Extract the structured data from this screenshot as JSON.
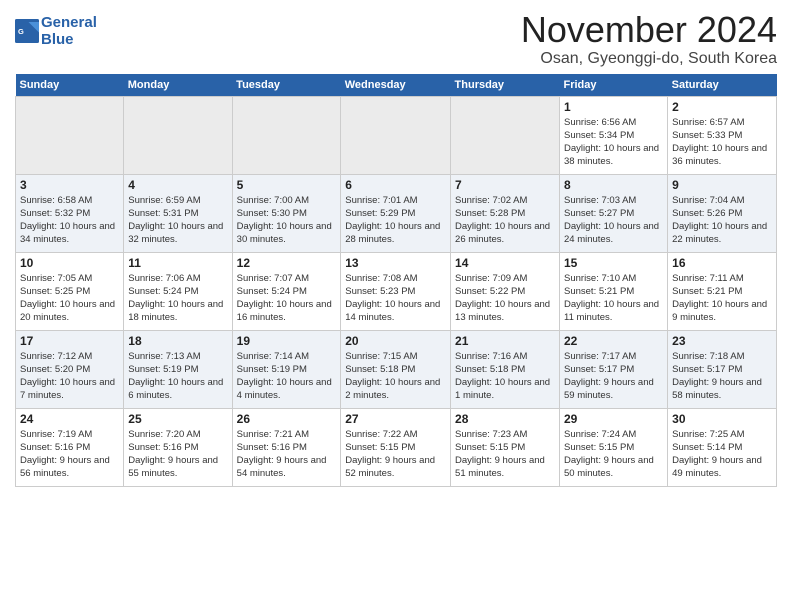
{
  "app": {
    "logo_line1": "General",
    "logo_line2": "Blue"
  },
  "header": {
    "month": "November 2024",
    "location": "Osan, Gyeonggi-do, South Korea"
  },
  "weekdays": [
    "Sunday",
    "Monday",
    "Tuesday",
    "Wednesday",
    "Thursday",
    "Friday",
    "Saturday"
  ],
  "weeks": [
    [
      {
        "day": "",
        "info": ""
      },
      {
        "day": "",
        "info": ""
      },
      {
        "day": "",
        "info": ""
      },
      {
        "day": "",
        "info": ""
      },
      {
        "day": "",
        "info": ""
      },
      {
        "day": "1",
        "info": "Sunrise: 6:56 AM\nSunset: 5:34 PM\nDaylight: 10 hours and 38 minutes."
      },
      {
        "day": "2",
        "info": "Sunrise: 6:57 AM\nSunset: 5:33 PM\nDaylight: 10 hours and 36 minutes."
      }
    ],
    [
      {
        "day": "3",
        "info": "Sunrise: 6:58 AM\nSunset: 5:32 PM\nDaylight: 10 hours and 34 minutes."
      },
      {
        "day": "4",
        "info": "Sunrise: 6:59 AM\nSunset: 5:31 PM\nDaylight: 10 hours and 32 minutes."
      },
      {
        "day": "5",
        "info": "Sunrise: 7:00 AM\nSunset: 5:30 PM\nDaylight: 10 hours and 30 minutes."
      },
      {
        "day": "6",
        "info": "Sunrise: 7:01 AM\nSunset: 5:29 PM\nDaylight: 10 hours and 28 minutes."
      },
      {
        "day": "7",
        "info": "Sunrise: 7:02 AM\nSunset: 5:28 PM\nDaylight: 10 hours and 26 minutes."
      },
      {
        "day": "8",
        "info": "Sunrise: 7:03 AM\nSunset: 5:27 PM\nDaylight: 10 hours and 24 minutes."
      },
      {
        "day": "9",
        "info": "Sunrise: 7:04 AM\nSunset: 5:26 PM\nDaylight: 10 hours and 22 minutes."
      }
    ],
    [
      {
        "day": "10",
        "info": "Sunrise: 7:05 AM\nSunset: 5:25 PM\nDaylight: 10 hours and 20 minutes."
      },
      {
        "day": "11",
        "info": "Sunrise: 7:06 AM\nSunset: 5:24 PM\nDaylight: 10 hours and 18 minutes."
      },
      {
        "day": "12",
        "info": "Sunrise: 7:07 AM\nSunset: 5:24 PM\nDaylight: 10 hours and 16 minutes."
      },
      {
        "day": "13",
        "info": "Sunrise: 7:08 AM\nSunset: 5:23 PM\nDaylight: 10 hours and 14 minutes."
      },
      {
        "day": "14",
        "info": "Sunrise: 7:09 AM\nSunset: 5:22 PM\nDaylight: 10 hours and 13 minutes."
      },
      {
        "day": "15",
        "info": "Sunrise: 7:10 AM\nSunset: 5:21 PM\nDaylight: 10 hours and 11 minutes."
      },
      {
        "day": "16",
        "info": "Sunrise: 7:11 AM\nSunset: 5:21 PM\nDaylight: 10 hours and 9 minutes."
      }
    ],
    [
      {
        "day": "17",
        "info": "Sunrise: 7:12 AM\nSunset: 5:20 PM\nDaylight: 10 hours and 7 minutes."
      },
      {
        "day": "18",
        "info": "Sunrise: 7:13 AM\nSunset: 5:19 PM\nDaylight: 10 hours and 6 minutes."
      },
      {
        "day": "19",
        "info": "Sunrise: 7:14 AM\nSunset: 5:19 PM\nDaylight: 10 hours and 4 minutes."
      },
      {
        "day": "20",
        "info": "Sunrise: 7:15 AM\nSunset: 5:18 PM\nDaylight: 10 hours and 2 minutes."
      },
      {
        "day": "21",
        "info": "Sunrise: 7:16 AM\nSunset: 5:18 PM\nDaylight: 10 hours and 1 minute."
      },
      {
        "day": "22",
        "info": "Sunrise: 7:17 AM\nSunset: 5:17 PM\nDaylight: 9 hours and 59 minutes."
      },
      {
        "day": "23",
        "info": "Sunrise: 7:18 AM\nSunset: 5:17 PM\nDaylight: 9 hours and 58 minutes."
      }
    ],
    [
      {
        "day": "24",
        "info": "Sunrise: 7:19 AM\nSunset: 5:16 PM\nDaylight: 9 hours and 56 minutes."
      },
      {
        "day": "25",
        "info": "Sunrise: 7:20 AM\nSunset: 5:16 PM\nDaylight: 9 hours and 55 minutes."
      },
      {
        "day": "26",
        "info": "Sunrise: 7:21 AM\nSunset: 5:16 PM\nDaylight: 9 hours and 54 minutes."
      },
      {
        "day": "27",
        "info": "Sunrise: 7:22 AM\nSunset: 5:15 PM\nDaylight: 9 hours and 52 minutes."
      },
      {
        "day": "28",
        "info": "Sunrise: 7:23 AM\nSunset: 5:15 PM\nDaylight: 9 hours and 51 minutes."
      },
      {
        "day": "29",
        "info": "Sunrise: 7:24 AM\nSunset: 5:15 PM\nDaylight: 9 hours and 50 minutes."
      },
      {
        "day": "30",
        "info": "Sunrise: 7:25 AM\nSunset: 5:14 PM\nDaylight: 9 hours and 49 minutes."
      }
    ]
  ]
}
